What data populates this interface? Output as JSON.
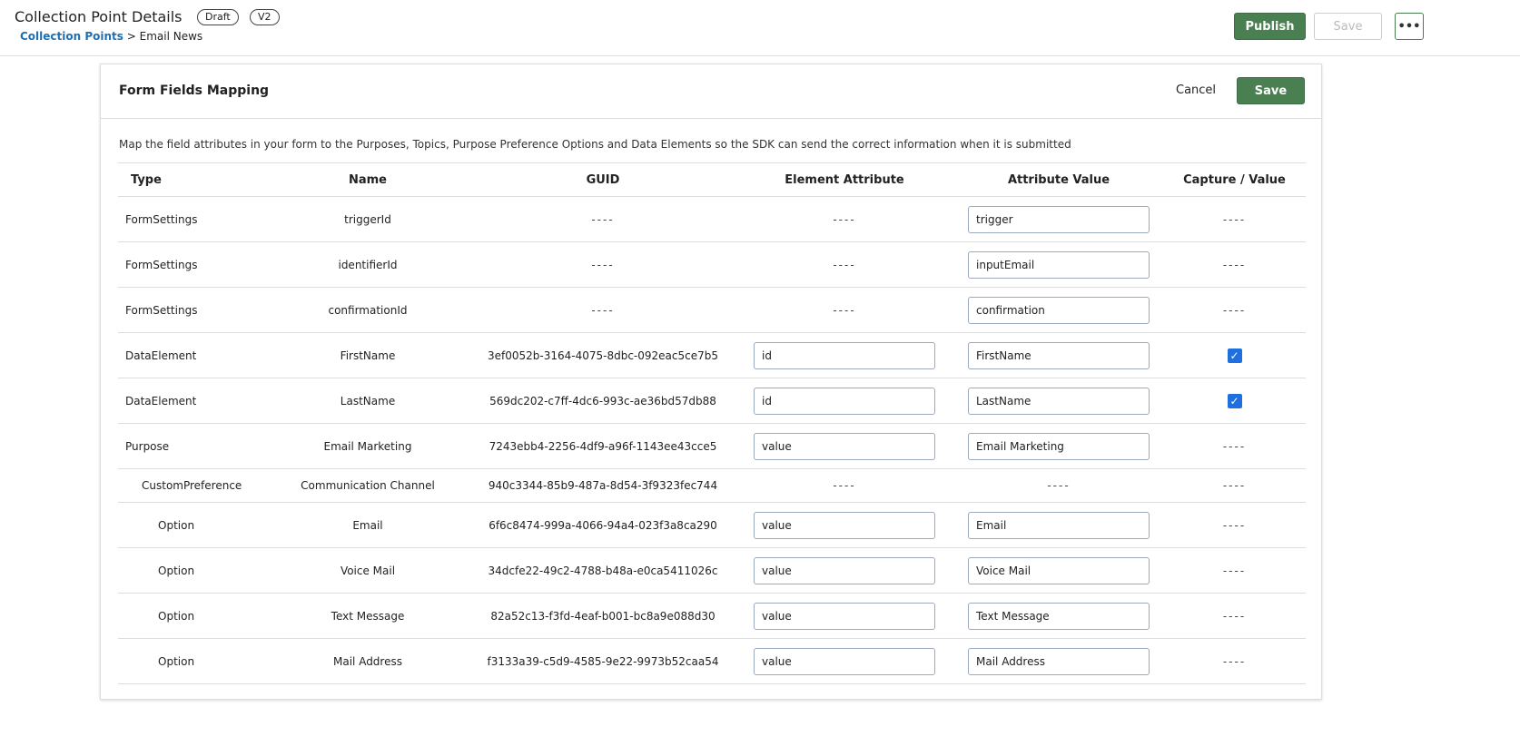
{
  "header": {
    "title": "Collection Point Details",
    "badges": [
      "Draft",
      "V2"
    ],
    "breadcrumb": {
      "link": "Collection Points",
      "sep": ">",
      "current": "Email News"
    },
    "publish": "Publish",
    "save": "Save",
    "more": "•••"
  },
  "card": {
    "title": "Form Fields Mapping",
    "cancel": "Cancel",
    "save": "Save",
    "description": "Map the field attributes in your form to the Purposes, Topics, Purpose Preference Options and Data Elements so the SDK can send the correct information when it is submitted"
  },
  "columns": [
    "Type",
    "Name",
    "GUID",
    "Element Attribute",
    "Attribute Value",
    "Capture / Value"
  ],
  "dash": "----",
  "check": "✓",
  "rows": [
    {
      "type": "FormSettings",
      "name": "triggerId",
      "guid": "----",
      "element": "----",
      "value": "trigger",
      "capture": "----"
    },
    {
      "type": "FormSettings",
      "name": "identifierId",
      "guid": "----",
      "element": "----",
      "value": "inputEmail",
      "capture": "----"
    },
    {
      "type": "FormSettings",
      "name": "confirmationId",
      "guid": "----",
      "element": "----",
      "value": "confirmation",
      "capture": "----"
    },
    {
      "type": "DataElement",
      "name": "FirstName",
      "guid": "3ef0052b-3164-4075-8dbc-092eac5ce7b5",
      "element": "id",
      "value": "FirstName",
      "capture": "checked"
    },
    {
      "type": "DataElement",
      "name": "LastName",
      "guid": "569dc202-c7ff-4dc6-993c-ae36bd57db88",
      "element": "id",
      "value": "LastName",
      "capture": "checked"
    },
    {
      "type": "Purpose",
      "name": "Email Marketing",
      "guid": "7243ebb4-2256-4df9-a96f-1143ee43cce5",
      "element": "value",
      "value": "Email Marketing",
      "capture": "----"
    },
    {
      "type": "CustomPreference",
      "name": "Communication Channel",
      "guid": "940c3344-85b9-487a-8d54-3f9323fec744",
      "element": "----",
      "value": "----",
      "capture": "----"
    },
    {
      "type": "Option",
      "name": "Email",
      "guid": "6f6c8474-999a-4066-94a4-023f3a8ca290",
      "element": "value",
      "value": "Email",
      "capture": "----"
    },
    {
      "type": "Option",
      "name": "Voice Mail",
      "guid": "34dcfe22-49c2-4788-b48a-e0ca5411026c",
      "element": "value",
      "value": "Voice Mail",
      "capture": "----"
    },
    {
      "type": "Option",
      "name": "Text Message",
      "guid": "82a52c13-f3fd-4eaf-b001-bc8a9e088d30",
      "element": "value",
      "value": "Text Message",
      "capture": "----"
    },
    {
      "type": "Option",
      "name": "Mail Address",
      "guid": "f3133a39-c5d9-4585-9e22-9973b52caa54",
      "element": "value",
      "value": "Mail Address",
      "capture": "----"
    }
  ]
}
